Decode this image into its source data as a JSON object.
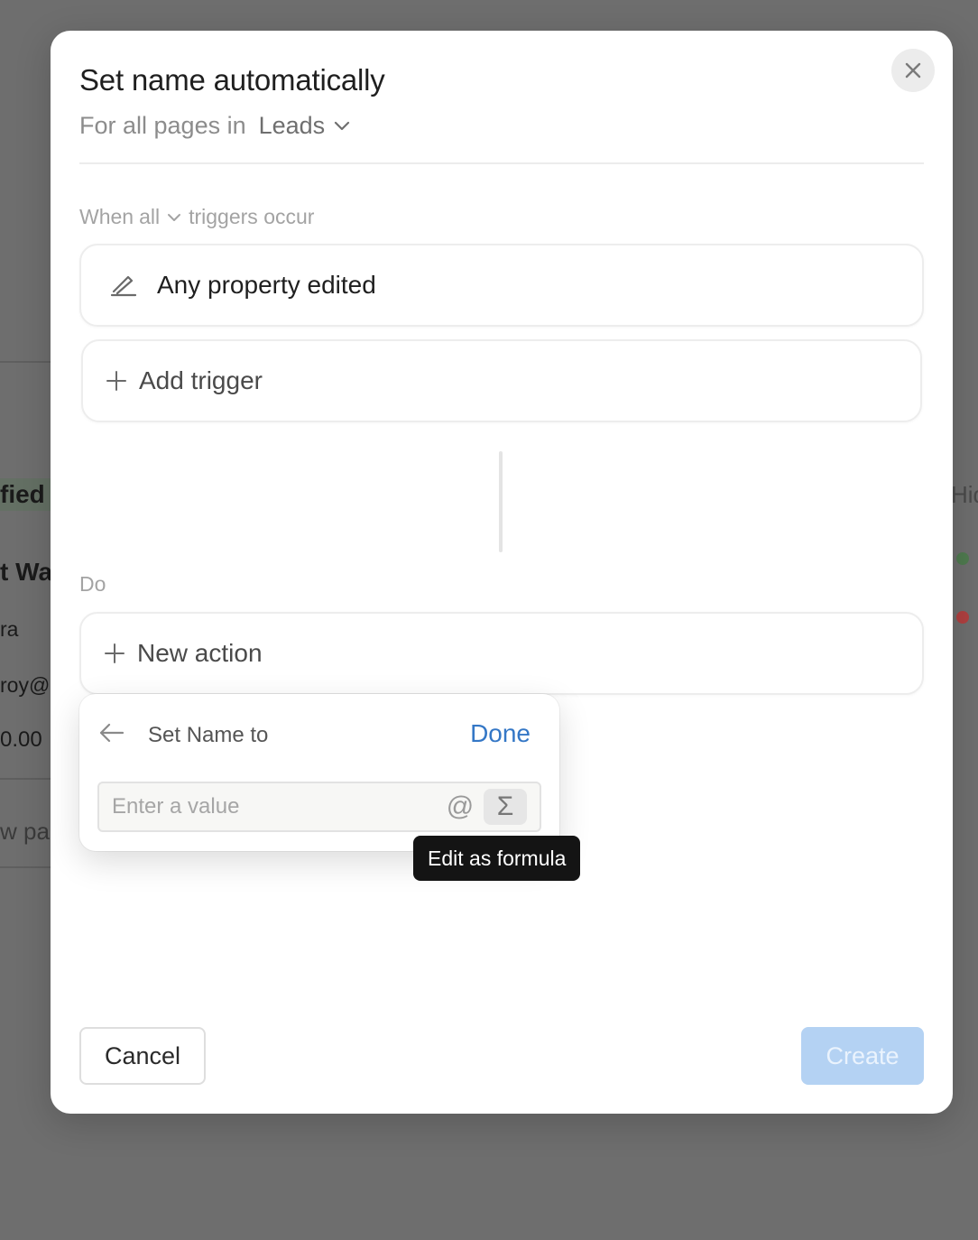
{
  "background": {
    "fragments": [
      "fied",
      "t Wa",
      "ra",
      "roy@",
      "0.00",
      "w pa",
      "Hid"
    ],
    "status_colors": {
      "green": "#4f7a4f",
      "red": "#b04040"
    }
  },
  "modal": {
    "title": "Set name automatically",
    "scope_prefix": "For all pages in",
    "scope_database": "Leads",
    "when_prefix": "When",
    "when_mode": "all",
    "when_suffix": "triggers occur",
    "trigger": {
      "label": "Any property edited",
      "icon": "edit-pencil-icon"
    },
    "add_trigger_label": "Add trigger",
    "do_label": "Do",
    "new_action_label": "New action",
    "popover": {
      "title": "Set Name to",
      "done_label": "Done",
      "input_placeholder": "Enter a value",
      "input_value": "",
      "mention_symbol": "@",
      "formula_symbol": "Σ"
    },
    "tooltip": "Edit as formula",
    "cancel_label": "Cancel",
    "create_label": "Create",
    "colors": {
      "accent": "#3477c6",
      "create_disabled_bg": "#b4d2f3"
    }
  }
}
